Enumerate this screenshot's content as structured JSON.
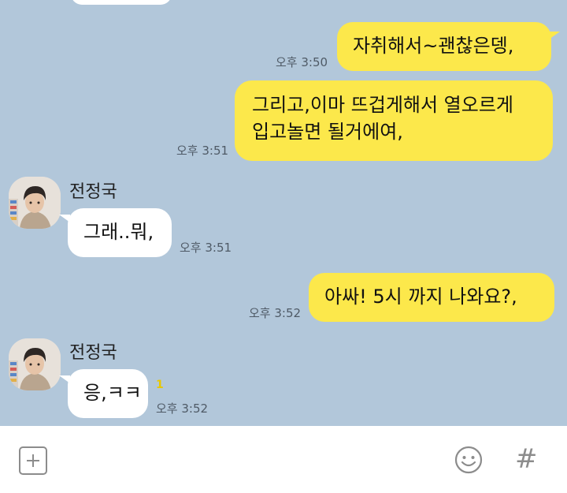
{
  "messages": [
    {
      "from": "me",
      "text": "자취해서~괜찮은뎅,",
      "time": "오후 3:50"
    },
    {
      "from": "me",
      "lines": [
        "그리고,이마 뜨겁게해서 열오르게",
        "입고놀면 될거에여,"
      ],
      "time": "오후 3:51"
    },
    {
      "from": "them",
      "sender": "전정국",
      "text": "그래..뭐,",
      "time": "오후 3:51"
    },
    {
      "from": "me",
      "text": "아싸! 5시 까지 나와요?,",
      "time": "오후 3:52"
    },
    {
      "from": "them",
      "sender": "전정국",
      "text": "응,ㅋㅋ",
      "unread": "1",
      "time": "오후 3:52"
    }
  ],
  "input_bar": {
    "plus_icon": "plus-box-icon",
    "emoji_icon": "smiley-icon",
    "hash_label": "#"
  },
  "colors": {
    "background": "#b2c7da",
    "my_bubble": "#fce84b",
    "their_bubble": "#ffffff",
    "input_bar": "#ffffff"
  }
}
